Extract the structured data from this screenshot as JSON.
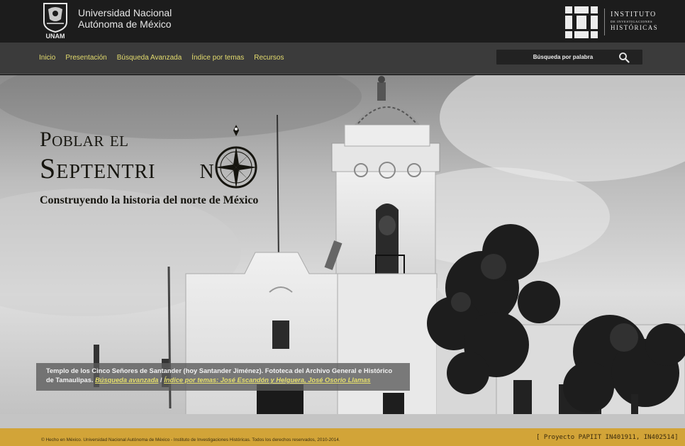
{
  "header": {
    "unam_abbr": "UNAM",
    "university_line1": "Universidad Nacional",
    "university_line2": "Autónoma de México",
    "institute_line1": "INSTITUTO",
    "institute_line2": "DE INVESTIGACIONES",
    "institute_line3": "HISTÓRICAS"
  },
  "nav": {
    "items": [
      {
        "label": "Inicio"
      },
      {
        "label": "Presentación"
      },
      {
        "label": "Búsqueda Avanzada"
      },
      {
        "label": "Índice por temas"
      },
      {
        "label": "Recursos"
      }
    ]
  },
  "search": {
    "placeholder": "Búsqueda por palabra",
    "icon": "search-icon"
  },
  "hero": {
    "title_line1": "Poblar el",
    "title_line2": "Septentri",
    "title_end": "n",
    "subtitle": "Construyendo la historia del norte de México"
  },
  "caption": {
    "text": "Templo de los Cinco Señores de Santander (hoy Santander Jiménez). Fototeca del Archivo General e Histórico de Tamaulipas. ",
    "link1": "Búsqueda avanzada",
    "separator": " / ",
    "link2": "Índice por temas: José Escandón y Helguera, José Osorio Llamas"
  },
  "footer": {
    "copyright": "© Hecho en México. Universidad Nacional Autónoma de México - Instituto de Investigaciones Históricas. Todos los derechos reservados, 2010-2014.",
    "project": "[ Proyecto PAPIIT IN401911, IN402514]"
  },
  "colors": {
    "header_bg": "#1c1c1c",
    "nav_bg": "#3b3b3b",
    "nav_link": "#e4dc6e",
    "footer_bg": "#d2a438"
  }
}
